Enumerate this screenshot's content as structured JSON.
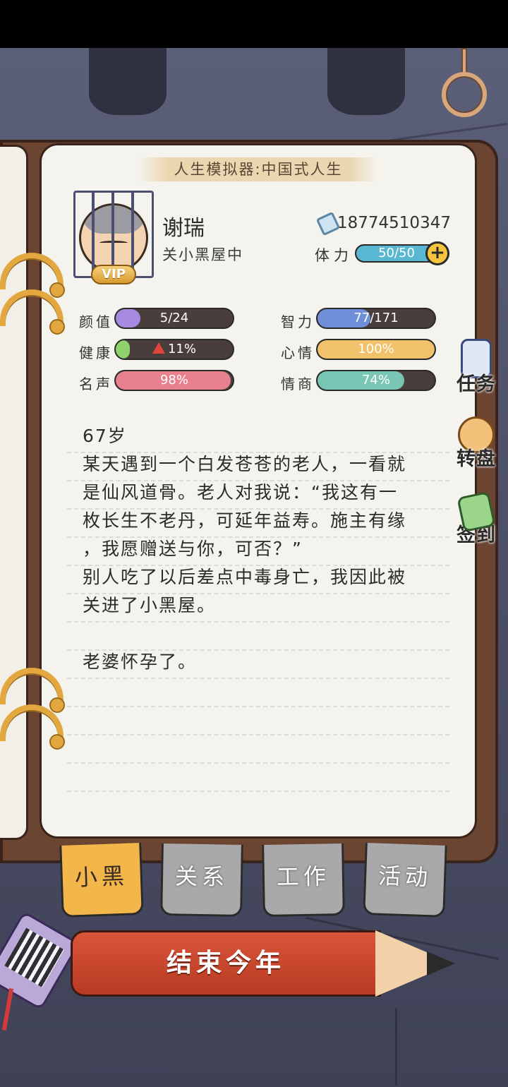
{
  "header": {
    "title": "人生模拟器:中国式人生"
  },
  "profile": {
    "name": "谢瑞",
    "status": "关小黑屋中",
    "badge": "VIP",
    "phone": "18774510347",
    "stamina_label": "体力",
    "stamina_text": "50/50",
    "stamina_fraction": 1.0
  },
  "stats": [
    {
      "label": "颜值",
      "text": "5/24",
      "fraction": 0.21,
      "color": "#a58ae0"
    },
    {
      "label": "智力",
      "text": "77/171",
      "fraction": 0.45,
      "color": "#6f8fd8"
    },
    {
      "label": "健康",
      "text": "11%",
      "fraction": 0.11,
      "color": "#8fd16b",
      "warning": true
    },
    {
      "label": "心情",
      "text": "100%",
      "fraction": 1.0,
      "color": "#f1c26a"
    },
    {
      "label": "名声",
      "text": "98%",
      "fraction": 0.98,
      "color": "#e8808d"
    },
    {
      "label": "情商",
      "text": "74%",
      "fraction": 0.74,
      "color": "#79c6b5"
    }
  ],
  "side_buttons": [
    {
      "label": "任务",
      "icon": "clipboard-icon"
    },
    {
      "label": "转盘",
      "icon": "wheel-icon"
    },
    {
      "label": "签到",
      "icon": "notebook-pen-icon"
    }
  ],
  "story": {
    "age": "67岁",
    "lines": [
      "某天遇到一个白发苍苍的老人，一看就",
      "是仙风道骨。老人对我说：“我这有一",
      "枚长生不老丹，可延年益寿。施主有缘",
      "，我愿赠送与你，可否？”",
      "别人吃了以后差点中毒身亡，我因此被",
      "关进了小黑屋。",
      "",
      "老婆怀孕了。"
    ]
  },
  "tabs": [
    {
      "label": "小黑屋",
      "active": true
    },
    {
      "label": "关系",
      "active": false
    },
    {
      "label": "工作",
      "active": false
    },
    {
      "label": "活动",
      "active": false
    }
  ],
  "end_year_button": "结束今年"
}
